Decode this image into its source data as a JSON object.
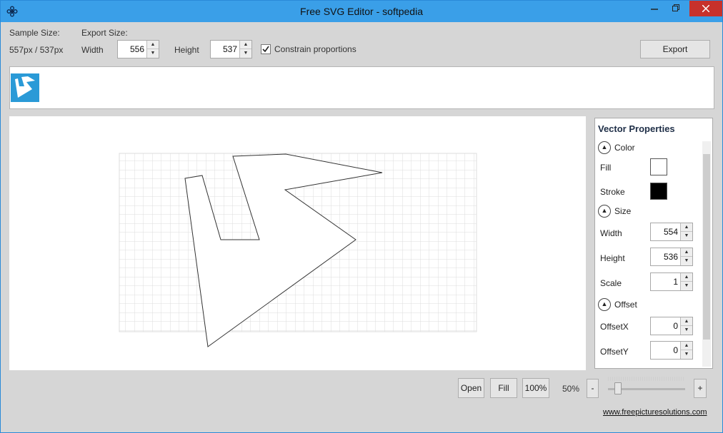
{
  "window": {
    "title": "Free SVG Editor - softpedia"
  },
  "toolbar": {
    "sample_size_label": "Sample Size:",
    "sample_size_value": "557px / 537px",
    "export_size_label": "Export Size:",
    "width_label": "Width",
    "width_value": "556",
    "height_label": "Height",
    "height_value": "537",
    "constrain_label": "Constrain proportions",
    "constrain_checked": true,
    "export_button": "Export"
  },
  "properties": {
    "title": "Vector Properties",
    "color_section": "Color",
    "fill_label": "Fill",
    "fill_color": "#ffffff",
    "stroke_label": "Stroke",
    "stroke_color": "#000000",
    "size_section": "Size",
    "width_label": "Width",
    "width_value": "554",
    "height_label": "Height",
    "height_value": "536",
    "scale_label": "Scale",
    "scale_value": "1",
    "offset_section": "Offset",
    "offsetx_label": "OffsetX",
    "offsetx_value": "0",
    "offsety_label": "OffsetY",
    "offsety_value": "0"
  },
  "bottom": {
    "open_button": "Open",
    "fill_button": "Fill",
    "zoom100_button": "100%",
    "zoom_value": "50%",
    "zoom_minus": "-",
    "zoom_plus": "+",
    "website_link": "www.freepicturesolutions.com"
  },
  "colors": {
    "titlebar": "#3a9fe8",
    "thumb_bg": "#2a9ad7",
    "close": "#c7312b"
  },
  "icons": {
    "app": "flower-icon",
    "check": "checkmark-icon",
    "collapse": "chevron-up-icon"
  }
}
